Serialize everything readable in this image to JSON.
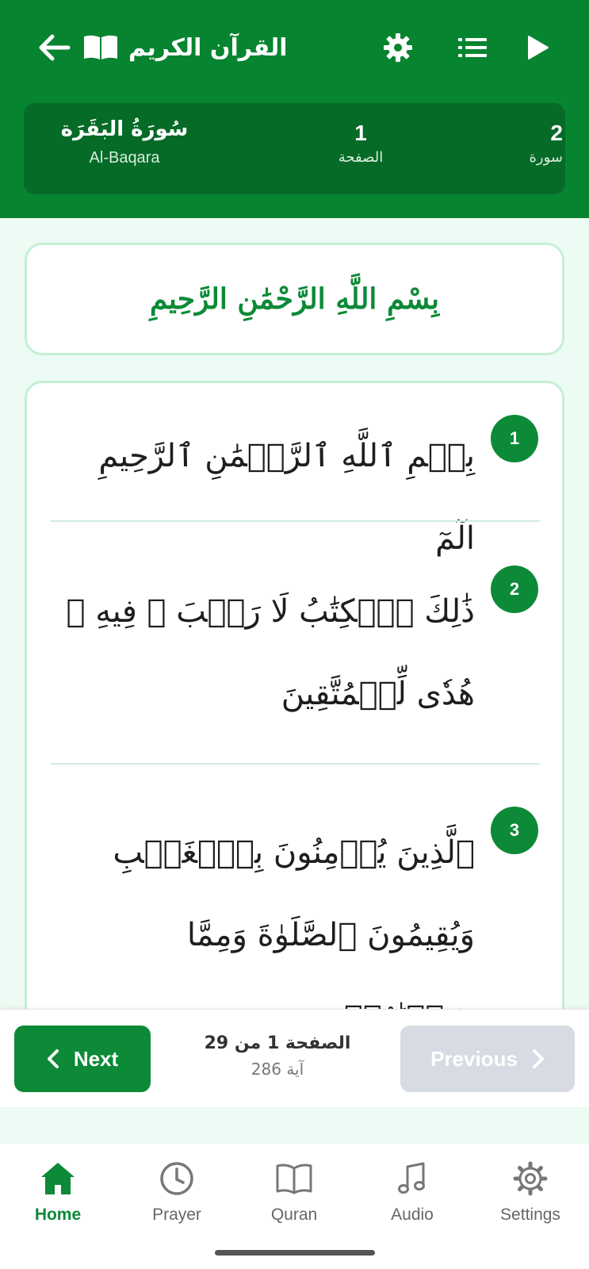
{
  "header": {
    "title": "القرآن الكريم",
    "accent": "#07842f"
  },
  "info": {
    "surah_arabic": "سُورَةُ البَقَرَة",
    "surah_english": "Al-Baqara",
    "page_number": "1",
    "page_label": "الصفحة",
    "surah_number": "2",
    "surah_label": "سورة"
  },
  "bismillah": "بِسْمِ اللَّهِ الرَّحْمَٰنِ الرَّحِيمِ",
  "verses": [
    {
      "number": "1",
      "text": "بِسۡمِ ٱللَّهِ ٱلرَّحۡمَٰنِ ٱلرَّحِيمِ الٓمٓ"
    },
    {
      "number": "2",
      "text": "ذَٰلِكَ ٱلۡكِتَٰبُ لَا رَيۡبَ ۛ فِيهِ ۛ هُدٗى لِّلۡمُتَّقِينَ"
    },
    {
      "number": "3",
      "text": "ٱلَّذِينَ يُؤۡمِنُونَ بِٱلۡغَيۡبِ وَيُقِيمُونَ ٱلصَّلَوٰةَ وَمِمَّا رَزَقۡنَٰهُمۡ"
    }
  ],
  "pager": {
    "next_label": "Next",
    "previous_label": "Previous",
    "page_text": "الصفحة 1 من 29",
    "ayah_count": "286 آية"
  },
  "nav": {
    "items": [
      {
        "label": "Home",
        "icon": "home-icon",
        "active": true
      },
      {
        "label": "Prayer",
        "icon": "clock-icon"
      },
      {
        "label": "Quran",
        "icon": "book-icon"
      },
      {
        "label": "Audio",
        "icon": "music-icon"
      },
      {
        "label": "Settings",
        "icon": "gear-icon"
      }
    ]
  }
}
